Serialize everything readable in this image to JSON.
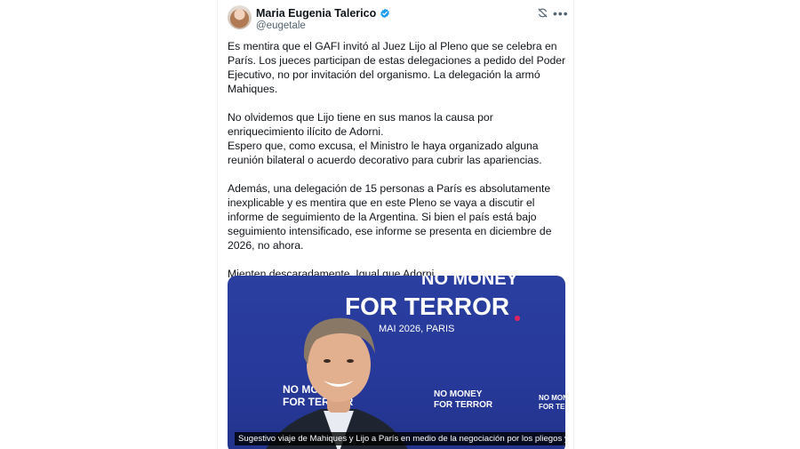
{
  "author": {
    "name": "Maria Eugenia Talerico",
    "handle": "@eugetale",
    "verified": true
  },
  "icons": {
    "verified": "verified-badge-icon",
    "grok": "grok-icon",
    "more": "more-options-icon"
  },
  "tweet": {
    "paragraphs": [
      "Es mentira que el GAFI invitó al Juez Lijo al Pleno que se celebra en París. Los jueces participan de estas delegaciones a pedido del Poder Ejecutivo, no por invitación del organismo. La delegación la armó Mahiques.",
      "No olvidemos que Lijo tiene en sus manos la causa por enriquecimiento ilícito de Adorni.\nEspero que, como excusa, el Ministro le haya organizado alguna reunión bilateral o acuerdo decorativo para cubrir las apariencias.",
      "Además, una delegación de 15 personas a París es absolutamente inexplicable y es mentira que en este Pleno se vaya a discutir el informe de seguimiento de la Argentina. Si bien el país está bajo seguimiento intensificado, ese informe se presenta en diciembre de 2026, no ahora.",
      "Mienten descaradamente. Igual que Adorni."
    ]
  },
  "media": {
    "backdrop": {
      "line1": "NO MONEY",
      "line2": "FOR TERROR",
      "date": "MAI 2026, PARIS",
      "repeat_no_money": "NO MONEY",
      "repeat_for_terror": "FOR TERROR"
    },
    "caption": "Sugestivo viaje de Mahiques y Lijo a París en medio de la negociación por los pliegos y ..."
  },
  "colors": {
    "verified": "#1d9bf0",
    "backdrop": "#2a3fa0",
    "accent_dot": "#e0245e"
  }
}
